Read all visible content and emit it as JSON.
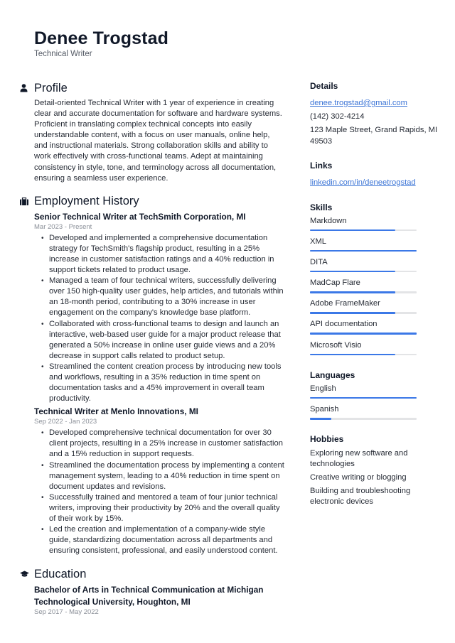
{
  "header": {
    "name": "Denee Trogstad",
    "job_title": "Technical Writer"
  },
  "profile": {
    "title": "Profile",
    "icon": "person-icon",
    "text": "Detail-oriented Technical Writer with 1 year of experience in creating clear and accurate documentation for software and hardware systems. Proficient in translating complex technical concepts into easily understandable content, with a focus on user manuals, online help, and instructional materials. Strong collaboration skills and ability to work effectively with cross-functional teams. Adept at maintaining consistency in style, tone, and terminology across all documentation, ensuring a seamless user experience."
  },
  "employment": {
    "title": "Employment History",
    "icon": "briefcase-icon",
    "jobs": [
      {
        "heading": "Senior Technical Writer at TechSmith Corporation, MI",
        "dates": "Mar 2023 - Present",
        "bullets": [
          "Developed and implemented a comprehensive documentation strategy for TechSmith's flagship product, resulting in a 25% increase in customer satisfaction ratings and a 40% reduction in support tickets related to product usage.",
          "Managed a team of four technical writers, successfully delivering over 150 high-quality user guides, help articles, and tutorials within an 18-month period, contributing to a 30% increase in user engagement on the company's knowledge base platform.",
          "Collaborated with cross-functional teams to design and launch an interactive, web-based user guide for a major product release that generated a 50% increase in online user guide views and a 20% decrease in support calls related to product setup.",
          "Streamlined the content creation process by introducing new tools and workflows, resulting in a 35% reduction in time spent on documentation tasks and a 45% improvement in overall team productivity."
        ]
      },
      {
        "heading": "Technical Writer at Menlo Innovations, MI",
        "dates": "Sep 2022 - Jan 2023",
        "bullets": [
          "Developed comprehensive technical documentation for over 30 client projects, resulting in a 25% increase in customer satisfaction and a 15% reduction in support requests.",
          "Streamlined the documentation process by implementing a content management system, leading to a 40% reduction in time spent on document updates and revisions.",
          "Successfully trained and mentored a team of four junior technical writers, improving their productivity by 20% and the overall quality of their work by 15%.",
          "Led the creation and implementation of a company-wide style guide, standardizing documentation across all departments and ensuring consistent, professional, and easily understood content."
        ]
      }
    ]
  },
  "education": {
    "title": "Education",
    "icon": "graduation-cap-icon",
    "heading": "Bachelor of Arts in Technical Communication at Michigan Technological University, Houghton, MI",
    "dates": "Sep 2017 - May 2022"
  },
  "details": {
    "title": "Details",
    "email": "denee.trogstad@gmail.com",
    "phone": "(142) 302-4214",
    "address": "123 Maple Street, Grand Rapids, MI 49503"
  },
  "links": {
    "title": "Links",
    "items": [
      "linkedin.com/in/deneetrogstad"
    ]
  },
  "skills": {
    "title": "Skills",
    "items": [
      {
        "label": "Markdown",
        "level": 0.8
      },
      {
        "label": "XML",
        "level": 1.0
      },
      {
        "label": "DITA",
        "level": 0.8
      },
      {
        "label": "MadCap Flare",
        "level": 0.8
      },
      {
        "label": "Adobe FrameMaker",
        "level": 0.8
      },
      {
        "label": "API documentation",
        "level": 1.0
      },
      {
        "label": "Microsoft Visio",
        "level": 0.8
      }
    ]
  },
  "languages": {
    "title": "Languages",
    "items": [
      {
        "label": "English",
        "level": 1.0
      },
      {
        "label": "Spanish",
        "level": 0.2
      }
    ]
  },
  "hobbies": {
    "title": "Hobbies",
    "items": [
      "Exploring new software and technologies",
      "Creative writing or blogging",
      "Building and troubleshooting electronic devices"
    ]
  },
  "colors": {
    "accent": "#3b78e7",
    "link": "#3b74d6",
    "bar_track": "#e3e4e6",
    "heading": "#101828",
    "muted": "#8a8f98"
  }
}
